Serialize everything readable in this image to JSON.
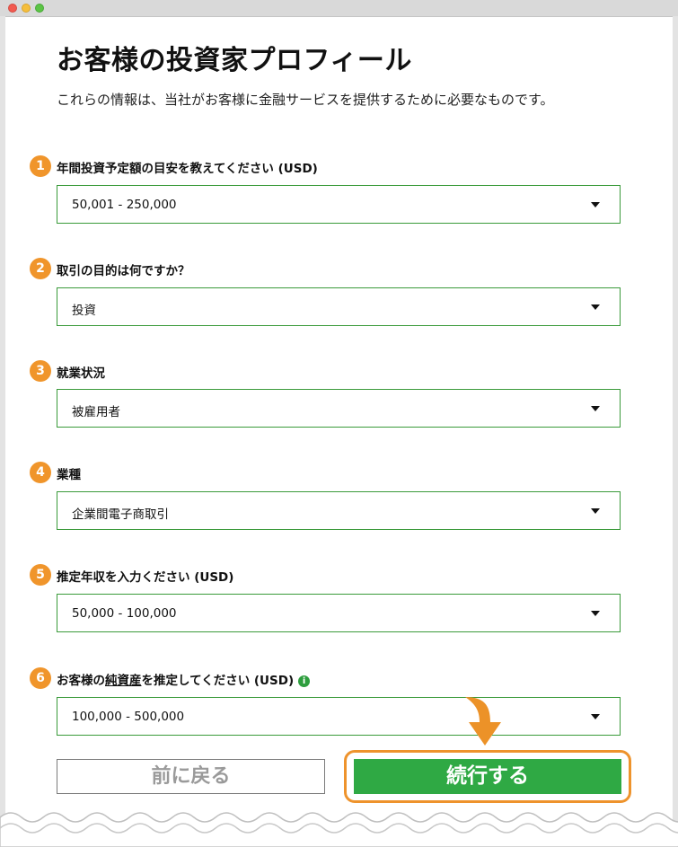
{
  "header": {
    "title": "お客様の投資家プロフィール",
    "subtitle": "これらの情報は、当社がお客様に金融サービスを提供するために必要なものです。"
  },
  "questions": [
    {
      "number": "1",
      "label": "年間投資予定額の目安を教えてください (USD)",
      "value": "50,001 - 250,000"
    },
    {
      "number": "2",
      "label": "取引の目的は何ですか？",
      "value": "投資"
    },
    {
      "number": "3",
      "label": "就業状況",
      "value": "被雇用者"
    },
    {
      "number": "4",
      "label": "業種",
      "value": "企業間電子商取引"
    },
    {
      "number": "5",
      "label": "推定年収を入力ください (USD)",
      "value": "50,000 - 100,000"
    },
    {
      "number": "6",
      "label_prefix": "お客様の",
      "label_underlined": "純資産",
      "label_suffix": "を推定してください (USD)",
      "info_icon": "i",
      "value": "100,000 - 500,000"
    }
  ],
  "buttons": {
    "back": "前に戻る",
    "continue": "続行する"
  },
  "colors": {
    "accent_orange": "#f0952b",
    "primary_green": "#2fa944",
    "border_green": "#3a9a3a"
  }
}
